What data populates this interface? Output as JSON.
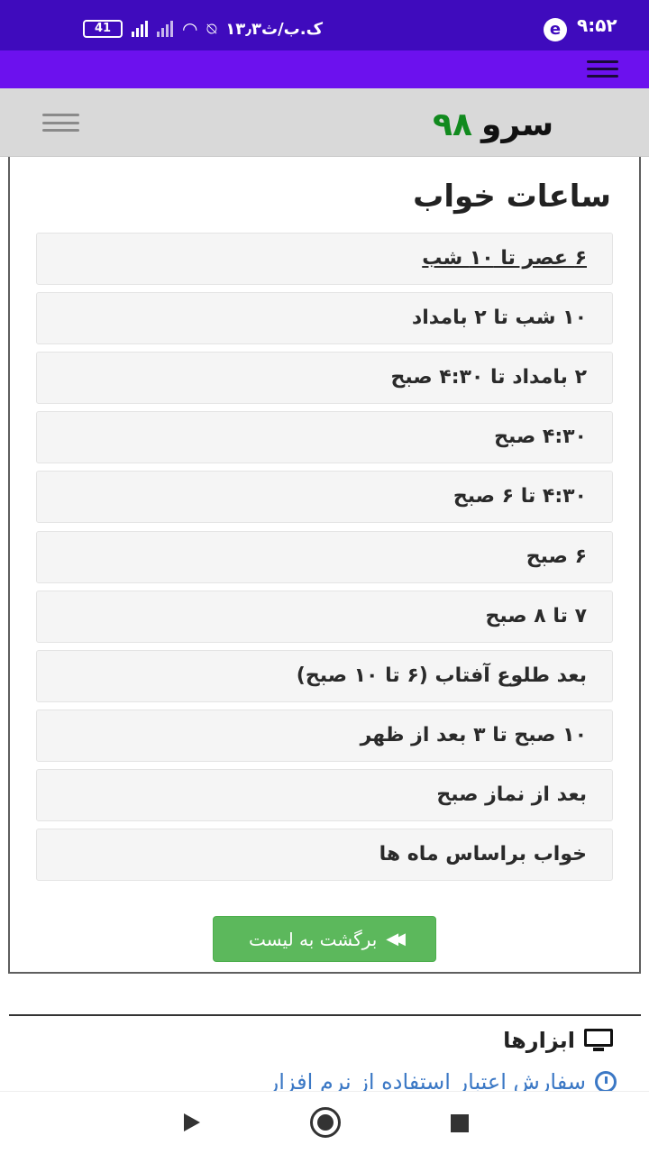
{
  "status_bar": {
    "time": "۹:۵۲",
    "app_icon": "e",
    "battery": "41",
    "network_text": "۱۳٫۳ک.ب/ث"
  },
  "header": {
    "logo_word": "سرو",
    "logo_number": "۹۸"
  },
  "page": {
    "title": "ساعات خواب",
    "items": [
      "۶ عصر تا ۱۰ شب",
      "۱۰ شب تا ۲ بامداد",
      "۲ بامداد تا ۴:۳۰ صبح",
      "۴:۳۰ صبح",
      "۴:۳۰ تا ۶ صبح",
      "۶ صبح",
      "۷ تا ۸ صبح",
      "بعد طلوع آفتاب (۶ تا ۱۰ صبح)",
      "۱۰ صبح تا ۳ بعد از ظهر",
      "بعد از نماز صبح",
      "خواب براساس ماه ها"
    ],
    "back_button": "برگشت به لیست"
  },
  "tools": {
    "title": "ابزارها",
    "link": "سفارش اعتبار استفاده از نرم افزار"
  },
  "colors": {
    "status_bar": "#3f0bbd",
    "toolbar": "#6c11ee",
    "logo_number": "#118a1e",
    "button": "#5cb85c",
    "link": "#3b78c5"
  }
}
